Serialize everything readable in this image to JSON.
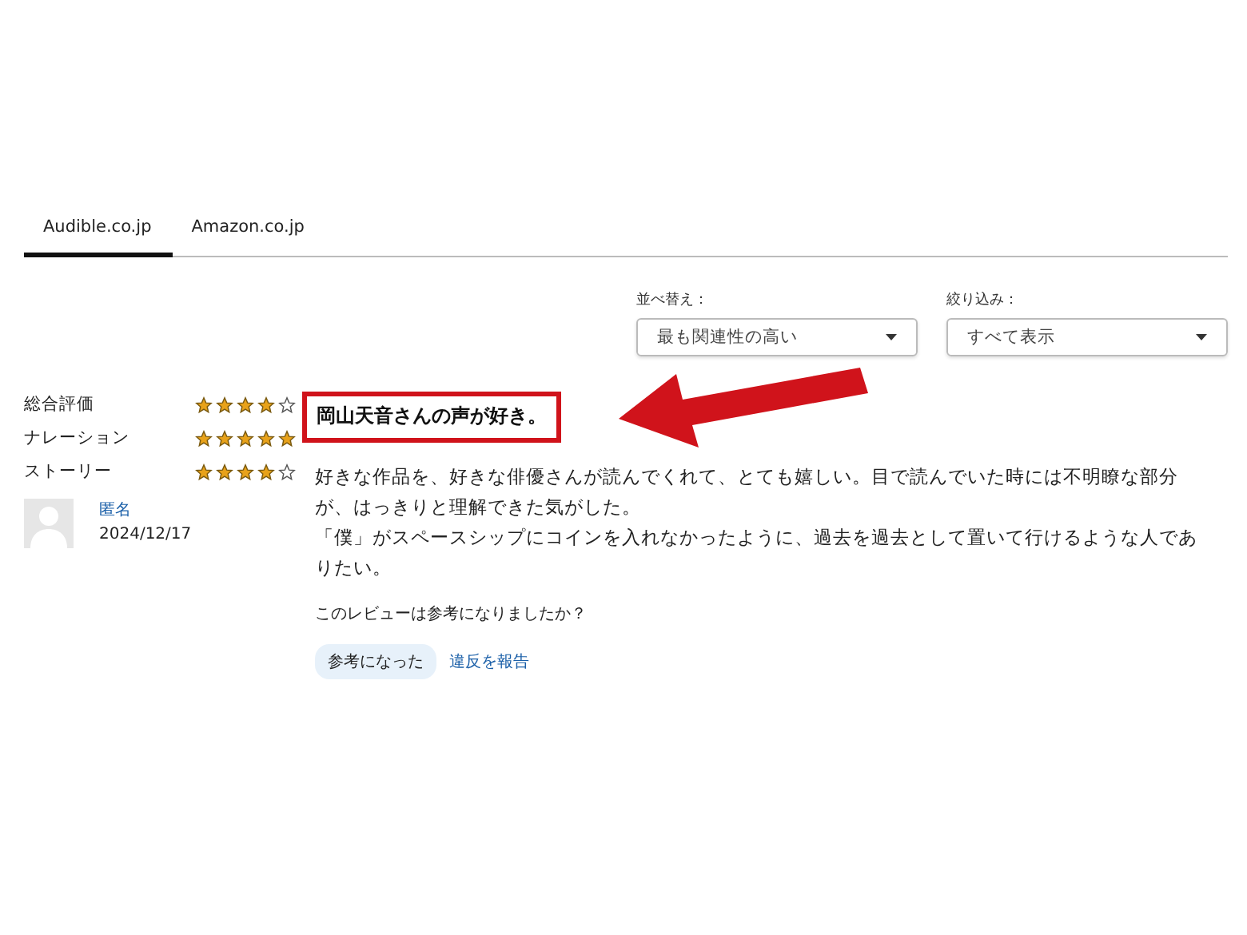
{
  "tabs": [
    {
      "label": "Audible.co.jp",
      "selected": true
    },
    {
      "label": "Amazon.co.jp",
      "selected": false
    }
  ],
  "filters": [
    {
      "label": "並べ替え：",
      "value": "最も関連性の高い"
    },
    {
      "label": "絞り込み：",
      "value": "すべて表示"
    }
  ],
  "ratings": [
    {
      "label": "総合評価",
      "stars": 4
    },
    {
      "label": "ナレーション",
      "stars": 5
    },
    {
      "label": "ストーリー",
      "stars": 4
    }
  ],
  "reviewer": {
    "name": "匿名",
    "date": "2024/12/17"
  },
  "review": {
    "title": "岡山天音さんの声が好き。",
    "highlighted": true,
    "paragraphs": [
      "好きな作品を、好きな俳優さんが読んでくれて、とても嬉しい。目で読んでいた時には不明瞭な部分が、はっきりと理解できた気がした。",
      "「僕」がスペースシップにコインを入れなかったように、過去を過去として置いて行けるような人でありたい。"
    ],
    "helpful_question": "このレビューは参考になりましたか？",
    "helpful_button": "参考になった",
    "report_link": "違反を報告"
  }
}
